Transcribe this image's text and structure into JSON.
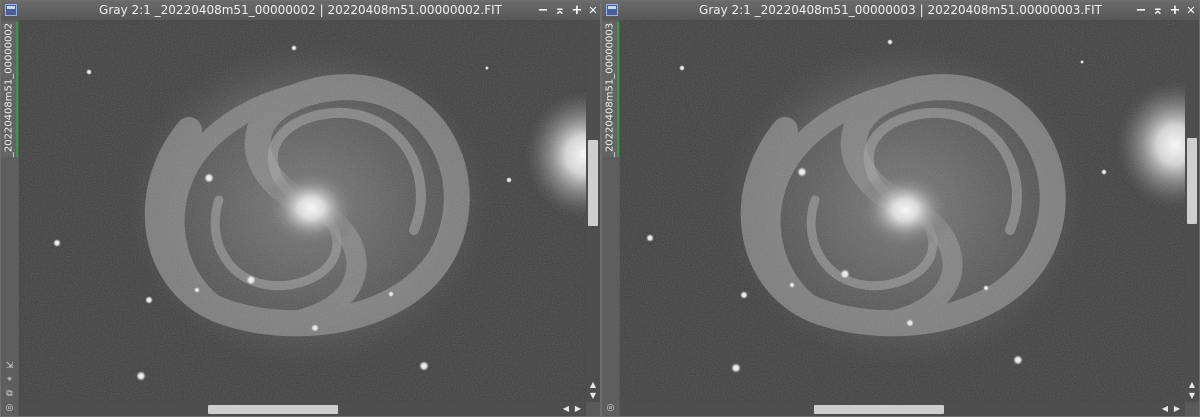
{
  "windows": [
    {
      "title": "Gray 2:1 _20220408m51_00000002 | 20220408m51.00000002.FIT",
      "side_tab": "_20220408m51_00000002",
      "controls": {
        "minimize": "−",
        "restore": "⌅",
        "maximize": "+",
        "close": "✕"
      },
      "side_icons": [
        "mask-icon",
        "crosshair-icon",
        "clone-icon",
        "identity-icon"
      ]
    },
    {
      "title": "Gray 2:1 _20220408m51_00000003 | 20220408m51.00000003.FIT",
      "side_tab": "_20220408m51_00000003",
      "controls": {
        "minimize": "−",
        "restore": "⌅",
        "maximize": "+",
        "close": "✕"
      },
      "side_icons": [
        "identity-icon"
      ]
    }
  ]
}
